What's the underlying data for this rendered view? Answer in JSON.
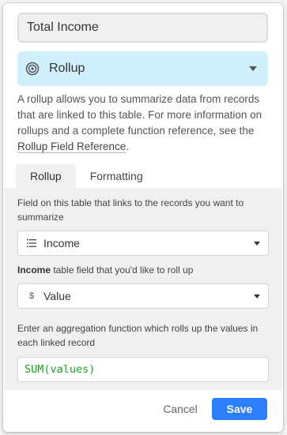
{
  "field": {
    "name_value": "Total Income",
    "type_label": "Rollup",
    "type_icon": "rollup-icon",
    "description": "A rollup allows you to summarize data from records that are linked to this table. For more information on rollups and a complete function reference, see the ",
    "reference_link": "Rollup Field Reference",
    "description_end": "."
  },
  "tabs": [
    {
      "label": "Rollup",
      "active": true
    },
    {
      "label": "Formatting",
      "active": false
    }
  ],
  "rollup": {
    "link_help": "Field on this table that links to the records you want to summarize",
    "link_field": {
      "value": "Income",
      "icon": "linked-records-icon"
    },
    "rollup_help_bold": "Income",
    "rollup_help_rest": " table field that you'd like to roll up",
    "rollup_field": {
      "value": "Value",
      "icon": "currency-icon",
      "icon_glyph": "$"
    },
    "aggregation_help": "Enter an aggregation function which rolls up the values in each linked record",
    "formula": "SUM(values)"
  },
  "actions": {
    "cancel_label": "Cancel",
    "save_label": "Save"
  },
  "colors": {
    "type_bg": "#d0f0fd",
    "save_bg": "#2d7ff9",
    "formula_text": "#20a020"
  }
}
